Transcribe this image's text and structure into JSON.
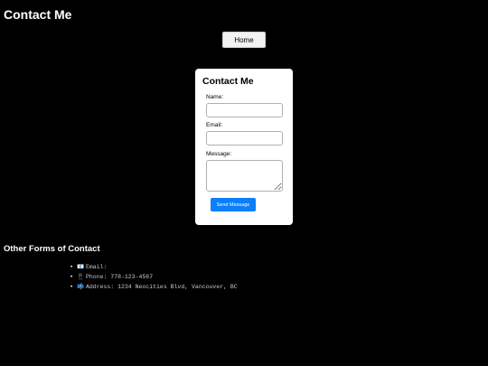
{
  "page": {
    "title": "Contact Me"
  },
  "nav": {
    "home_label": "Home"
  },
  "form": {
    "title": "Contact Me",
    "name_label": "Name:",
    "email_label": "Email:",
    "message_label": "Message:",
    "name_value": "",
    "email_value": "",
    "message_value": "",
    "submit_label": "Send Message"
  },
  "other": {
    "heading": "Other Forms of Contact",
    "items": [
      {
        "icon": "email-icon",
        "glyph": "📧",
        "text": "Email:"
      },
      {
        "icon": "phone-icon",
        "glyph": "📱",
        "text": "Phone: 778-123-4567"
      },
      {
        "icon": "mailbox-icon",
        "glyph": "📫",
        "text": "Address: 1234 Neocities Blvd, Vancouver, BC"
      }
    ]
  },
  "colors": {
    "background": "#000000",
    "card": "#ffffff",
    "accent": "#0b7ef8"
  }
}
